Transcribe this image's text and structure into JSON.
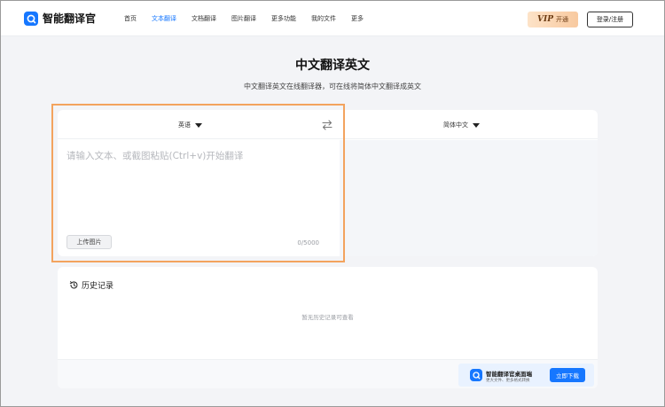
{
  "brand": {
    "name": "智能翻译官",
    "accent": "#1677ff"
  },
  "nav": {
    "items": [
      {
        "label": "首页",
        "active": false
      },
      {
        "label": "文本翻译",
        "active": true
      },
      {
        "label": "文档翻译",
        "active": false
      },
      {
        "label": "图片翻译",
        "active": false
      },
      {
        "label": "更多功能",
        "active": false
      },
      {
        "label": "我的文件",
        "active": false
      },
      {
        "label": "更多",
        "active": false
      }
    ]
  },
  "header": {
    "vip_mark": "VIP",
    "vip_label": "开通",
    "login_label": "登录/注册"
  },
  "hero": {
    "title": "中文翻译英文",
    "subtitle": "中文翻译英文在线翻译器，可在线将简体中文翻译成英文"
  },
  "translator": {
    "source_lang": "英语",
    "target_lang": "简体中文",
    "source_placeholder": "请输入文本、或截图粘贴(Ctrl+v)开始翻译",
    "source_value": "",
    "upload_label": "上传图片",
    "char_count": "0",
    "char_limit": "/5000",
    "highlight_color": "#f3a35e"
  },
  "history": {
    "title": "历史记录",
    "empty_text": "暂无历史记录可查看"
  },
  "promo": {
    "title": "智能翻译官桌面端",
    "subtitle": "更大文件、更多格式转换",
    "button_label": "立即下载"
  },
  "icons": {
    "logo": "translate-logo-icon",
    "swap": "swap-arrows-icon",
    "history": "history-clock-icon"
  }
}
